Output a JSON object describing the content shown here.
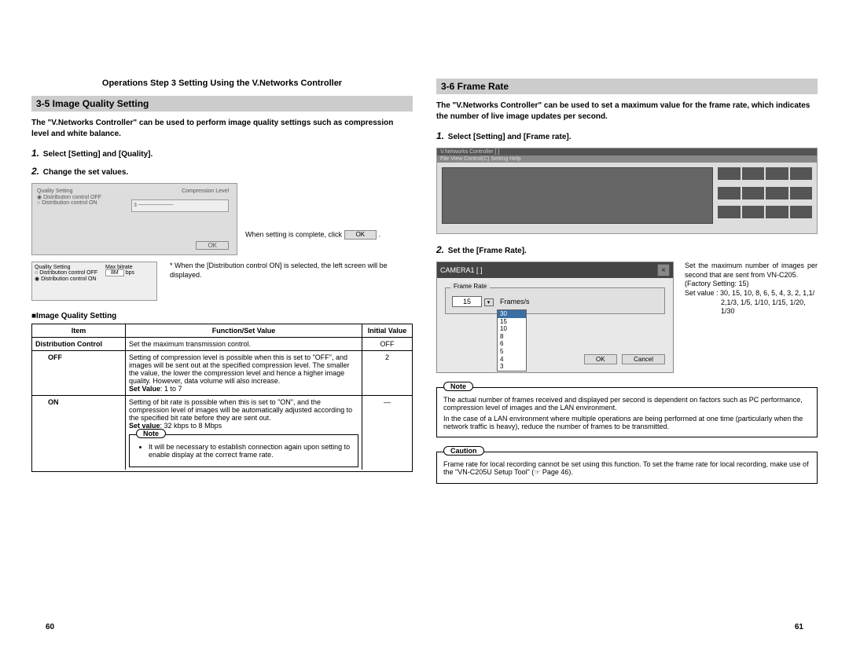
{
  "header": {
    "chapter": "Operations Step 3 Setting Using the V.Networks Controller"
  },
  "left": {
    "section": "3-5 Image Quality Setting",
    "intro": "The \"V.Networks Controller\" can be used to perform image quality settings such as compression level and white balance.",
    "step1_num": "1.",
    "step1": "Select [Setting] and [Quality].",
    "step2_num": "2.",
    "step2": "Change the set values.",
    "ok_annot_pre": "When setting is complete, click",
    "ok_annot_post": ".",
    "ok_label": "OK",
    "dist_note": "* When the [Distribution control ON] is selected, the left screen will be displayed.",
    "sub_fig_title": "Quality Setting",
    "sub_fig_opt1": "Distribution control OFF",
    "sub_fig_opt2": "Distribution control ON",
    "sub_fig_maxbitrate_label": "Max bitrate",
    "sub_fig_maxbitrate_val": "8M",
    "sub_fig_maxbitrate_unit": "bps",
    "fig_compression_label": "Compression Level",
    "table_head": "Image Quality Setting",
    "th_item": "Item",
    "th_func": "Function/Set Value",
    "th_init": "Initial Value",
    "row_dc_item": "Distribution Control",
    "row_dc_func": "Set the maximum transmission control.",
    "row_dc_init": "OFF",
    "row_off_item": "OFF",
    "row_off_func": "Setting of compression level is possible when this is set to \"OFF\", and images will be sent out at the specified compression level. The smaller the value, the lower the compression level and hence a higher image quality. However, data volume will also increase.",
    "row_off_setvalue_label": "Set Value",
    "row_off_setvalue": ": 1 to 7",
    "row_off_init": "2",
    "row_on_item": "ON",
    "row_on_func": "Setting of bit rate is possible when this is set to \"ON\", and the compression level of images will be automatically adjusted according to the specified bit rate before they are sent out.",
    "row_on_setvalue_label": "Set value",
    "row_on_setvalue": ": 32 kbps to 8 Mbps",
    "row_on_init": "—",
    "note_label": "Note",
    "note_body": "It will be necessary to establish connection again upon setting to enable display at the correct frame rate.",
    "page_num": "60"
  },
  "right": {
    "section": "3-6 Frame Rate",
    "intro": "The \"V.Networks Controller\" can be used to set a maximum value for the frame rate, which indicates the number of live image updates per second.",
    "step1_num": "1.",
    "step1": "Select [Setting] and [Frame rate].",
    "step2_num": "2.",
    "step2": "Set the [Frame Rate].",
    "panel_title": "CAMERA1  [ ]",
    "panel_group_label": "Frame Rate",
    "panel_value": "15",
    "panel_unit": "Frames/s",
    "panel_ok": "OK",
    "panel_cancel": "Cancel",
    "dropdown_options": [
      "30",
      "15",
      "10",
      "8",
      "6",
      "5",
      "4",
      "3"
    ],
    "annot1": "Set the maximum number of images per second that are sent from VN-C205.",
    "annot_factory": "(Factory Setting: 15)",
    "annot_setvalue_label": "Set value",
    "annot_setvalue_line1": ": 30, 15, 10, 8, 6, 5, 4, 3, 2, 1,1/",
    "annot_setvalue_line2": "2,1/3, 1/5, 1/10, 1/15, 1/20, 1/30",
    "note_label": "Note",
    "note_p1": "The actual number of frames received and displayed per second is dependent on factors such as PC performance, compression level of images and the LAN environment.",
    "note_p2": "In the case of a LAN environment where multiple operations are being performed at one time (particularly when the network traffic is heavy), reduce the number of frames to be transmitted.",
    "caution_label": "Caution",
    "caution_body": "Frame rate for local recording cannot be set using this function. To set the frame rate for local recording, make use of the \"VN-C205U Setup Tool\" (☞ Page 46).",
    "page_num": "61"
  }
}
